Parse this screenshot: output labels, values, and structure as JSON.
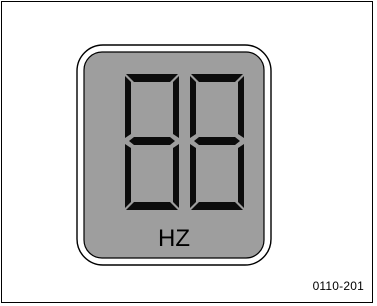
{
  "display": {
    "digits": [
      "8",
      "8"
    ],
    "unit": "HZ"
  },
  "figure_code": "0110-201",
  "colors": {
    "lcd_background": "#9e9e9e",
    "bezel": "#ffffff",
    "segment_dark": "#101010",
    "frame": "#000000"
  }
}
